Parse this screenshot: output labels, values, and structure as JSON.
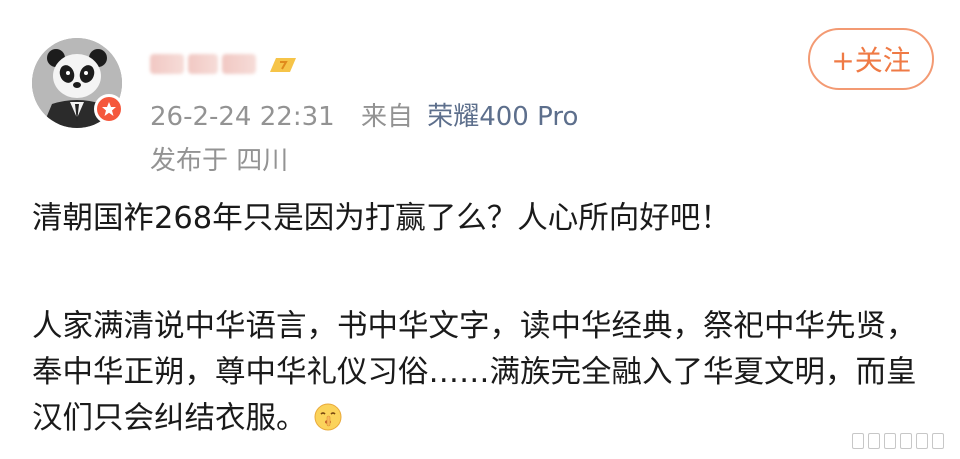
{
  "post": {
    "timestamp": "26-2-24 22:31",
    "source_prefix": "来自",
    "device": "荣耀400 Pro",
    "location": "发布于 四川",
    "follow_label": "+关注",
    "paragraphs": [
      "清朝国祚268年只是因为打赢了么？人心所向好吧！",
      "人家满清说中华语言，书中华文字，读中华经典，祭祀中华先贤，奉中华正朔，尊中华礼仪习俗……满族完全融入了华夏文明，而皇汉们只会纠结衣服。"
    ]
  },
  "icons": {
    "avatar": "panda-avatar",
    "verify": "verified-badge-icon",
    "member": "member-level-icon",
    "emoji": "shush-emoji-icon"
  },
  "colors": {
    "follow_accent": "#ef7a45",
    "meta_gray": "#939393",
    "device_link": "#5d6f8c",
    "verify_red": "#f5573c"
  }
}
